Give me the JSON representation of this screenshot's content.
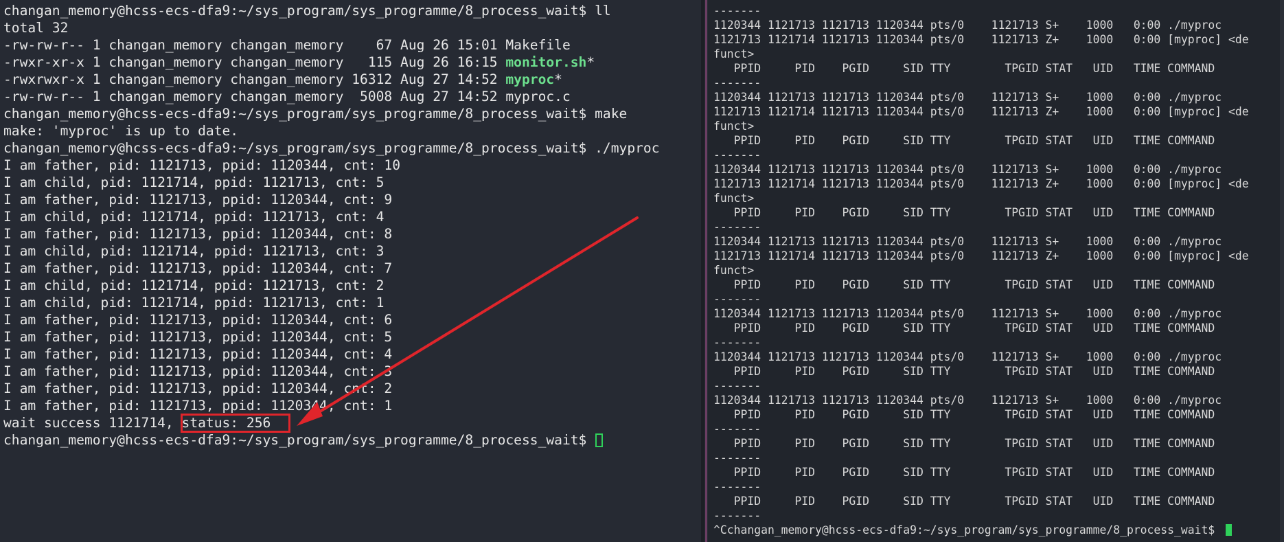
{
  "left_terminal": {
    "lines": [
      "changan_memory@hcss-ecs-dfa9:~/sys_program/sys_programme/8_process_wait$ ll",
      "total 32",
      "-rw-rw-r-- 1 changan_memory changan_memory    67 Aug 26 15:01 Makefile",
      "-rwxr-xr-x 1 changan_memory changan_memory   115 Aug 26 16:15 ",
      "-rwxrwxr-x 1 changan_memory changan_memory 16312 Aug 27 14:52 ",
      "-rw-rw-r-- 1 changan_memory changan_memory  5008 Aug 27 14:52 myproc.c",
      "changan_memory@hcss-ecs-dfa9:~/sys_program/sys_programme/8_process_wait$ make",
      "make: 'myproc' is up to date.",
      "changan_memory@hcss-ecs-dfa9:~/sys_program/sys_programme/8_process_wait$ ./myproc",
      "I am father, pid: 1121713, ppid: 1120344, cnt: 10",
      "I am child, pid: 1121714, ppid: 1121713, cnt: 5",
      "I am father, pid: 1121713, ppid: 1120344, cnt: 9",
      "I am child, pid: 1121714, ppid: 1121713, cnt: 4",
      "I am father, pid: 1121713, ppid: 1120344, cnt: 8",
      "I am child, pid: 1121714, ppid: 1121713, cnt: 3",
      "I am father, pid: 1121713, ppid: 1120344, cnt: 7",
      "I am child, pid: 1121714, ppid: 1121713, cnt: 2",
      "I am child, pid: 1121714, ppid: 1121713, cnt: 1",
      "I am father, pid: 1121713, ppid: 1120344, cnt: 6",
      "I am father, pid: 1121713, ppid: 1120344, cnt: 5",
      "I am father, pid: 1121713, ppid: 1120344, cnt: 4",
      "I am father, pid: 1121713, ppid: 1120344, cnt: 3",
      "I am father, pid: 1121713, ppid: 1120344, cnt: 2",
      "I am father, pid: 1121713, ppid: 1120344, cnt: 1",
      "wait success 1121714, status: 256",
      "changan_memory@hcss-ecs-dfa9:~/sys_program/sys_programme/8_process_wait$ "
    ],
    "monitor_name": "monitor.sh",
    "monitor_suffix": "*",
    "myproc_name": "myproc",
    "myproc_suffix": "*",
    "annotation_color": "#e0252b",
    "highlight_color": "#6de08e",
    "cursor_color": "#2fd15a"
  },
  "right_terminal": {
    "lines": [
      "-------",
      "1120344 1121713 1121713 1120344 pts/0    1121713 S+    1000   0:00 ./myproc",
      "1121713 1121714 1121713 1120344 pts/0    1121713 Z+    1000   0:00 [myproc] <de",
      "funct>",
      "   PPID     PID    PGID     SID TTY        TPGID STAT   UID   TIME COMMAND",
      "-------",
      "1120344 1121713 1121713 1120344 pts/0    1121713 S+    1000   0:00 ./myproc",
      "1121713 1121714 1121713 1120344 pts/0    1121713 Z+    1000   0:00 [myproc] <de",
      "funct>",
      "   PPID     PID    PGID     SID TTY        TPGID STAT   UID   TIME COMMAND",
      "-------",
      "1120344 1121713 1121713 1120344 pts/0    1121713 S+    1000   0:00 ./myproc",
      "1121713 1121714 1121713 1120344 pts/0    1121713 Z+    1000   0:00 [myproc] <de",
      "funct>",
      "   PPID     PID    PGID     SID TTY        TPGID STAT   UID   TIME COMMAND",
      "-------",
      "1120344 1121713 1121713 1120344 pts/0    1121713 S+    1000   0:00 ./myproc",
      "1121713 1121714 1121713 1120344 pts/0    1121713 Z+    1000   0:00 [myproc] <de",
      "funct>",
      "   PPID     PID    PGID     SID TTY        TPGID STAT   UID   TIME COMMAND",
      "-------",
      "1120344 1121713 1121713 1120344 pts/0    1121713 S+    1000   0:00 ./myproc",
      "   PPID     PID    PGID     SID TTY        TPGID STAT   UID   TIME COMMAND",
      "-------",
      "1120344 1121713 1121713 1120344 pts/0    1121713 S+    1000   0:00 ./myproc",
      "   PPID     PID    PGID     SID TTY        TPGID STAT   UID   TIME COMMAND",
      "-------",
      "1120344 1121713 1121713 1120344 pts/0    1121713 S+    1000   0:00 ./myproc",
      "   PPID     PID    PGID     SID TTY        TPGID STAT   UID   TIME COMMAND",
      "-------",
      "   PPID     PID    PGID     SID TTY        TPGID STAT   UID   TIME COMMAND",
      "-------",
      "   PPID     PID    PGID     SID TTY        TPGID STAT   UID   TIME COMMAND",
      "-------",
      "   PPID     PID    PGID     SID TTY        TPGID STAT   UID   TIME COMMAND",
      "-------",
      "^Cchangan_memory@hcss-ecs-dfa9:~/sys_program/sys_programme/8_process_wait$ "
    ]
  }
}
